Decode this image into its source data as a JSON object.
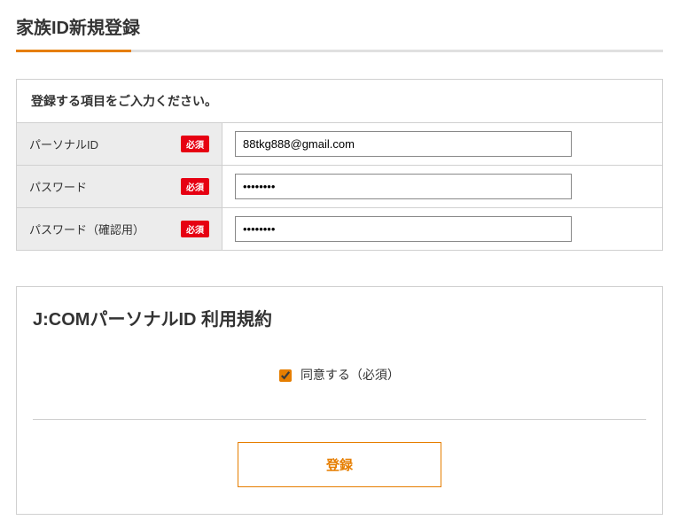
{
  "page_title": "家族ID新規登録",
  "instruction": "登録する項目をご入力ください。",
  "required_label": "必須",
  "fields": {
    "personal_id": {
      "label": "パーソナルID",
      "value": "88tkg888@gmail.com"
    },
    "password": {
      "label": "パスワード",
      "value": "••••••••"
    },
    "password_confirm": {
      "label": "パスワード（確認用）",
      "value": "••••••••"
    }
  },
  "terms": {
    "title": "J:COMパーソナルID 利用規約",
    "agree_label": "同意する（必須）",
    "agree_checked": true
  },
  "submit_label": "登録"
}
